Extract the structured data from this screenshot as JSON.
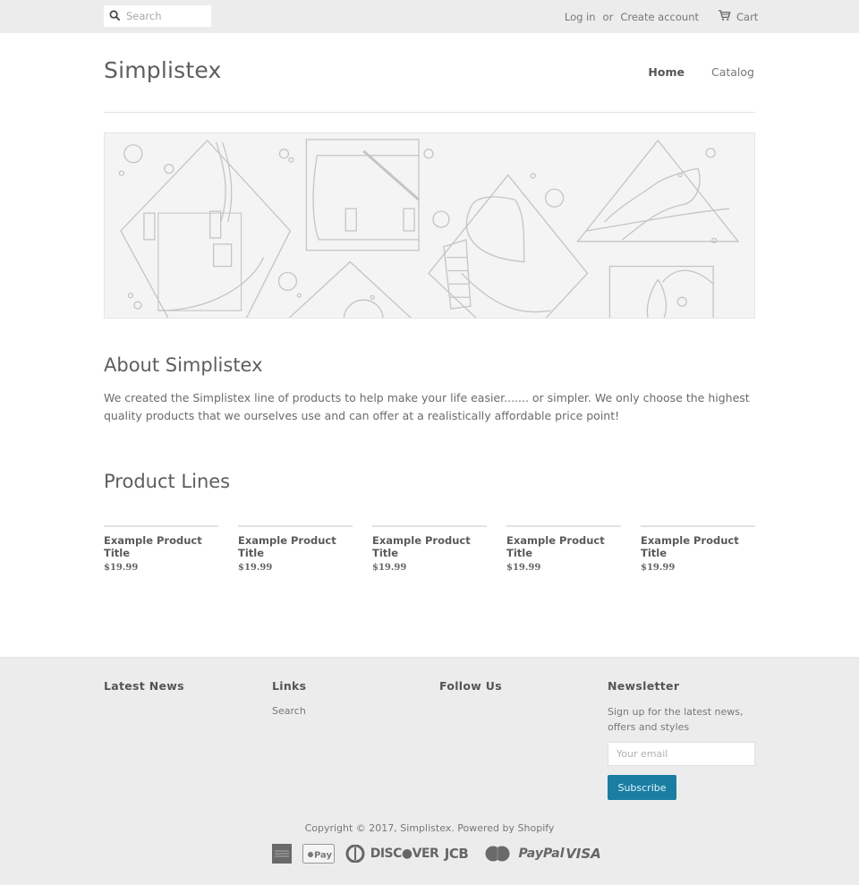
{
  "topbar": {
    "search_placeholder": "Search",
    "login_label": "Log in",
    "or_label": "or",
    "create_account_label": "Create account",
    "cart_label": "Cart"
  },
  "header": {
    "logo": "Simplistex",
    "nav": [
      {
        "label": "Home",
        "active": true
      },
      {
        "label": "Catalog",
        "active": false
      }
    ]
  },
  "hero": {
    "icon": "product-illustration-banner"
  },
  "about": {
    "title": "About Simplistex",
    "text": "We created the Simplistex line of products to help make your life easier....... or simpler. We only choose the highest quality products that we ourselves use and can offer at a realistically affordable price point!"
  },
  "products": {
    "title": "Product Lines",
    "items": [
      {
        "title": "Example Product Title",
        "price": "$19.99"
      },
      {
        "title": "Example Product Title",
        "price": "$19.99"
      },
      {
        "title": "Example Product Title",
        "price": "$19.99"
      },
      {
        "title": "Example Product Title",
        "price": "$19.99"
      },
      {
        "title": "Example Product Title",
        "price": "$19.99"
      }
    ]
  },
  "footer": {
    "latest_news_title": "Latest News",
    "links_title": "Links",
    "links": [
      {
        "label": "Search"
      }
    ],
    "follow_title": "Follow Us",
    "newsletter_title": "Newsletter",
    "newsletter_text": "Sign up for the latest news, offers and styles",
    "email_placeholder": "Your email",
    "subscribe_label": "Subscribe",
    "copyright_prefix": "Copyright © 2017, ",
    "copyright_store": "Simplistex",
    "copyright_powered": ". Powered by Shopify",
    "payment_methods": [
      "American Express",
      "Apple Pay",
      "Diners Club",
      "DISCOVER",
      "JCB",
      "Master",
      "PayPal",
      "VISA"
    ],
    "accent_color": "#1a7ea3"
  }
}
